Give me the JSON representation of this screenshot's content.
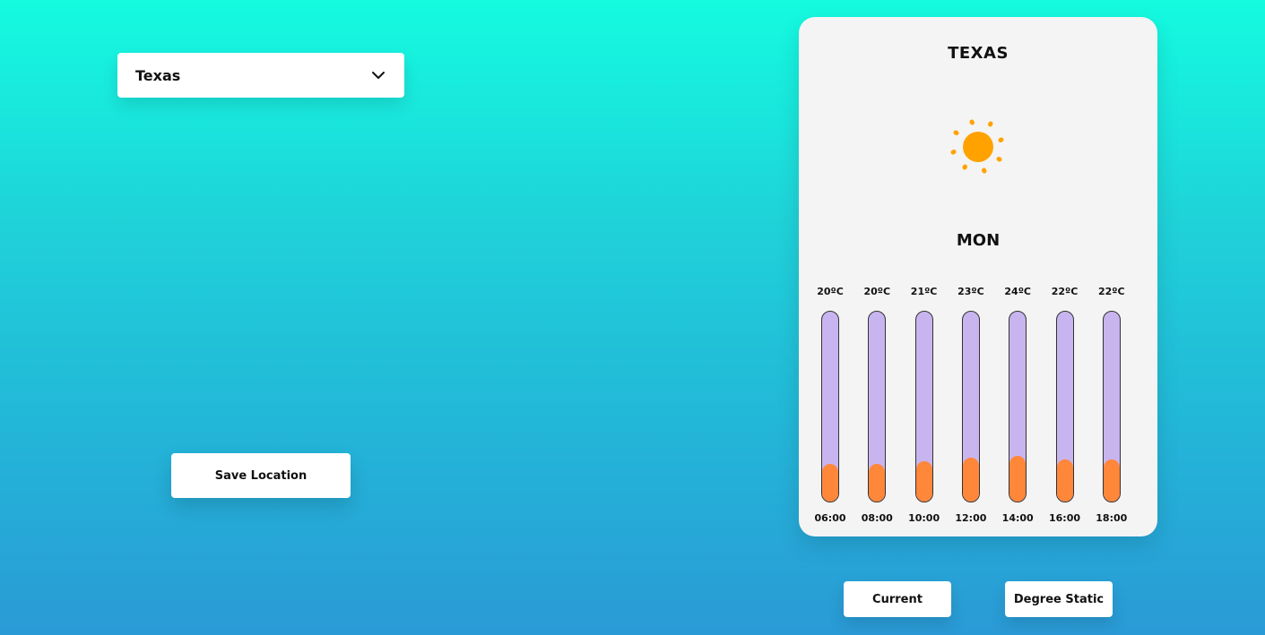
{
  "location_select": {
    "selected": "Texas",
    "icon": "chevron-down-icon"
  },
  "save_button": {
    "label": "Save Location"
  },
  "weather_card": {
    "city": "TEXAS",
    "condition_icon": "sun-icon",
    "day": "MON",
    "colors": {
      "tube": "#c8b5ef",
      "fill": "#ff873a",
      "sun": "#ffa200"
    },
    "hours": [
      {
        "temp": "20ºC",
        "time": "06:00",
        "value": 20
      },
      {
        "temp": "20ºC",
        "time": "08:00",
        "value": 20
      },
      {
        "temp": "21ºC",
        "time": "10:00",
        "value": 21
      },
      {
        "temp": "23ºC",
        "time": "12:00",
        "value": 23
      },
      {
        "temp": "24ºC",
        "time": "14:00",
        "value": 24
      },
      {
        "temp": "22ºC",
        "time": "16:00",
        "value": 22
      },
      {
        "temp": "22ºC",
        "time": "18:00",
        "value": 22
      }
    ]
  },
  "bottom_buttons": {
    "current": "Current",
    "degree_static": "Degree Static"
  }
}
